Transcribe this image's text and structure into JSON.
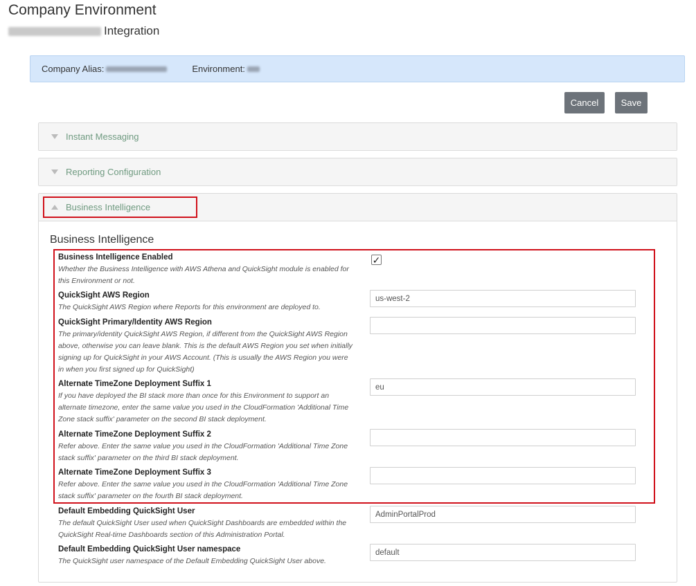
{
  "page": {
    "title": "Company Environment",
    "subtitle_suffix": "Integration"
  },
  "info": {
    "company_alias_label": "Company Alias:",
    "environment_label": "Environment:"
  },
  "toolbar": {
    "cancel_label": "Cancel",
    "save_label": "Save"
  },
  "panels": [
    {
      "label": "Instant Messaging",
      "expanded": false
    },
    {
      "label": "Reporting Configuration",
      "expanded": false
    },
    {
      "label": "Business Intelligence",
      "expanded": true
    }
  ],
  "bi": {
    "section_title": "Business Intelligence",
    "fields": [
      {
        "label": "Business Intelligence Enabled",
        "description": "Whether the Business Intelligence with AWS Athena and QuickSight module is enabled for this Environment or not.",
        "type": "checkbox",
        "checked": true,
        "check_glyph": "✓"
      },
      {
        "label": "QuickSight AWS Region",
        "description": "The QuickSight AWS Region where Reports for this environment are deployed to.",
        "type": "text",
        "value": "us-west-2"
      },
      {
        "label": "QuickSight Primary/Identity AWS Region",
        "description": "The primary/identity QuickSight AWS Region, if different from the QuickSight AWS Region above, otherwise you can leave blank. This is the default AWS Region you set when initially signing up for QuickSight in your AWS Account. (This is usually the AWS Region you were in when you first signed up for QuickSight)",
        "type": "text",
        "value": ""
      },
      {
        "label": "Alternate TimeZone Deployment Suffix 1",
        "description": "If you have deployed the BI stack more than once for this Environment to support an alternate timezone, enter the same value you used in the CloudFormation 'Additional Time Zone stack suffix' parameter on the second BI stack deployment.",
        "type": "text",
        "value": "eu"
      },
      {
        "label": "Alternate TimeZone Deployment Suffix 2",
        "description": "Refer above. Enter the same value you used in the CloudFormation 'Additional Time Zone stack suffix' parameter on the third BI stack deployment.",
        "type": "text",
        "value": ""
      },
      {
        "label": "Alternate TimeZone Deployment Suffix 3",
        "description": "Refer above. Enter the same value you used in the CloudFormation 'Additional Time Zone stack suffix' parameter on the fourth BI stack deployment.",
        "type": "text",
        "value": ""
      },
      {
        "label": "Default Embedding QuickSight User",
        "description": "The default QuickSight User used when QuickSight Dashboards are embedded within the QuickSight Real-time Dashboards section of this Administration Portal.",
        "type": "text",
        "value": "AdminPortalProd"
      },
      {
        "label": "Default Embedding QuickSight User namespace",
        "description": "The QuickSight user namespace of the Default Embedding QuickSight User above.",
        "type": "text",
        "value": "default"
      }
    ]
  },
  "colors": {
    "info_bar_bg": "#d6e7fb",
    "button_bg": "#6d737a",
    "panel_label": "#6f9a80",
    "highlight": "#d0101a"
  }
}
